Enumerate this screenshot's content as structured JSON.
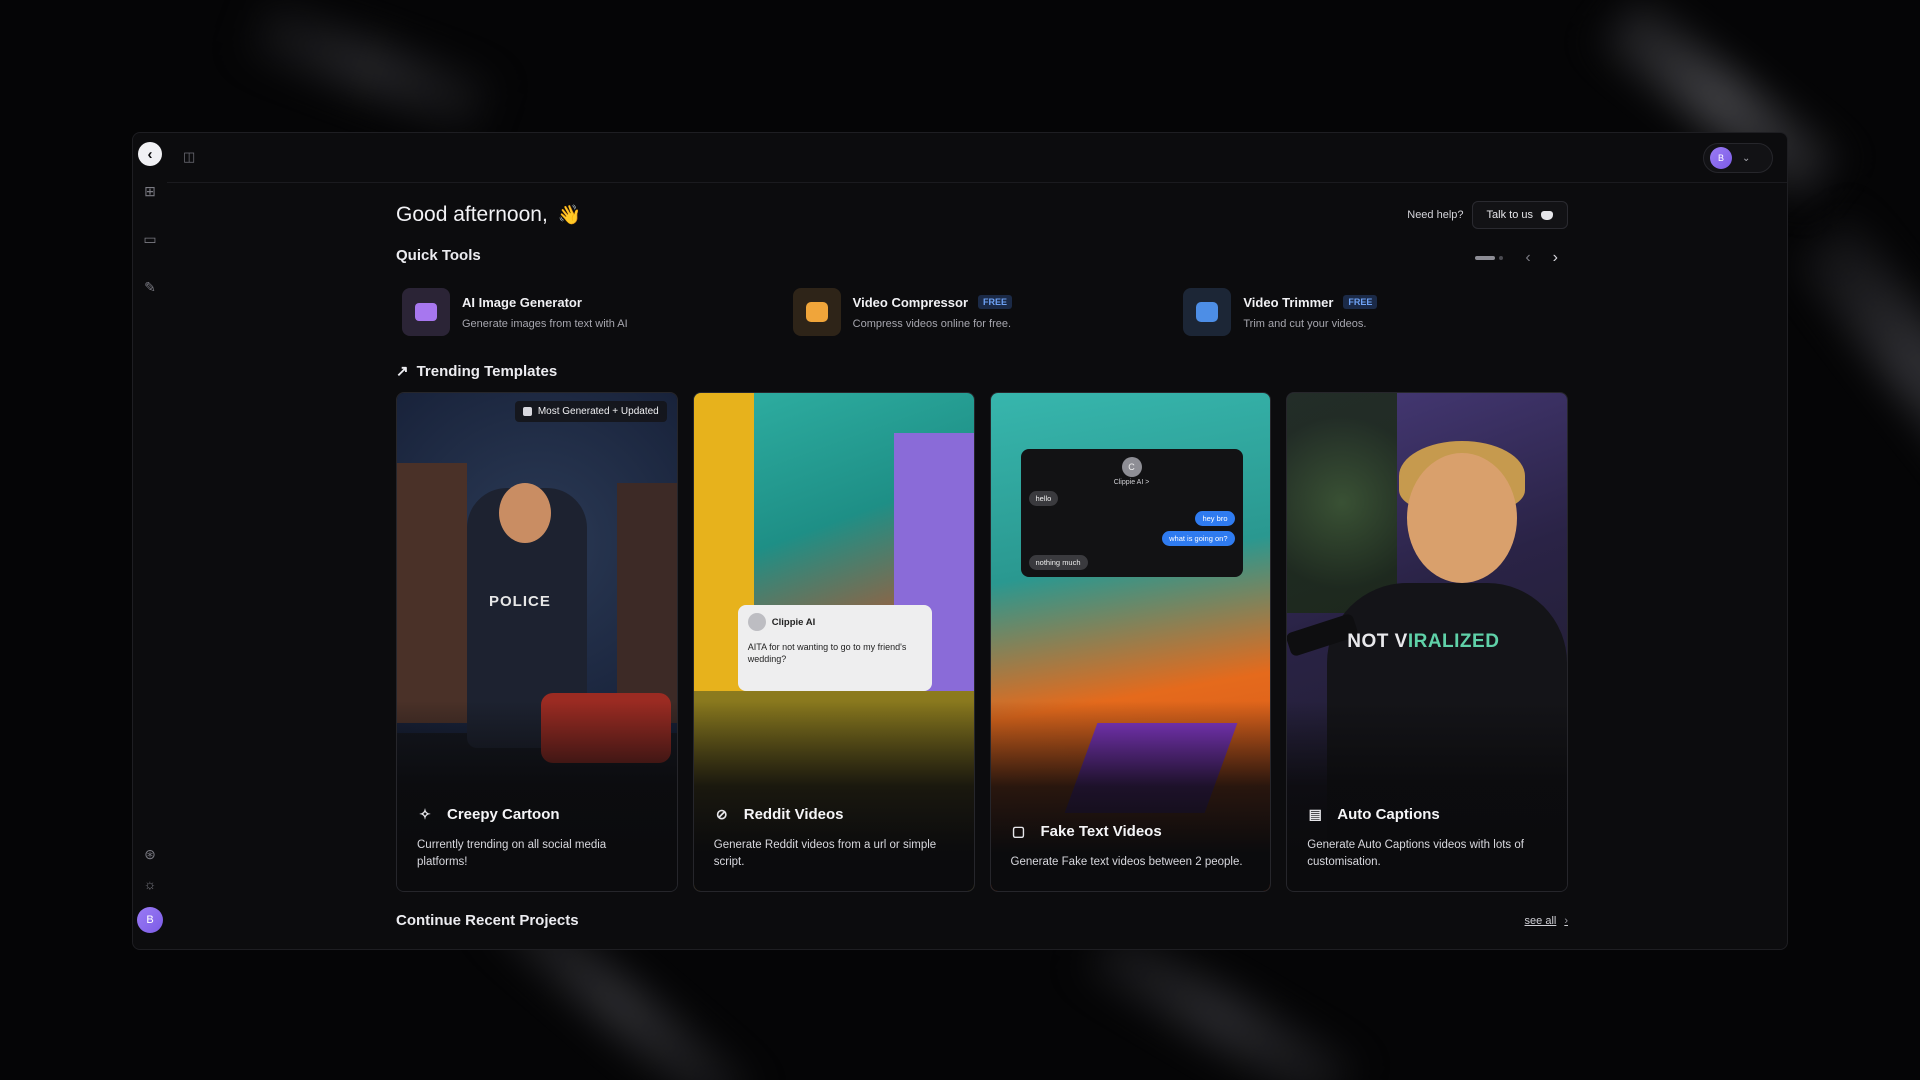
{
  "header": {
    "user_initial": "B"
  },
  "sidebar": {
    "items": [
      {
        "icon": "grid-icon"
      },
      {
        "icon": "clapperboard-icon"
      },
      {
        "icon": "wrench-icon"
      }
    ],
    "bottom": [
      {
        "icon": "settings-icon"
      },
      {
        "icon": "bug-icon"
      }
    ],
    "user_initial": "B"
  },
  "main": {
    "greeting": "Good afternoon,",
    "greeting_emoji": "👋",
    "help_text": "Need help?",
    "talk_button": "Talk to us",
    "quick_tools_title": "Quick Tools",
    "quick_tools": [
      {
        "name": "AI Image Generator",
        "desc": "Generate images from text with AI",
        "badge": ""
      },
      {
        "name": "Video Compressor",
        "desc": "Compress videos online for free.",
        "badge": "FREE"
      },
      {
        "name": "Video Trimmer",
        "desc": "Trim and cut your videos.",
        "badge": "FREE"
      }
    ],
    "trending_title": "Trending Templates",
    "templates": [
      {
        "title": "Creepy Cartoon",
        "desc": "Currently trending on all social media platforms!",
        "badge": "Most Generated + Updated",
        "art_text": "POLICE"
      },
      {
        "title": "Reddit Videos",
        "desc": "Generate Reddit videos from a url or simple script.",
        "post_user": "Clippie AI",
        "post_text": "AITA for not wanting to go to my friend's wedding?"
      },
      {
        "title": "Fake Text Videos",
        "desc": "Generate Fake text videos between 2 people.",
        "chat_name": "Clippie AI >",
        "chat_avatar": "C",
        "messages": [
          "hello",
          "hey bro",
          "what is going on?",
          "nothing much"
        ]
      },
      {
        "title": "Auto Captions",
        "desc": "Generate Auto Captions videos with lots of customisation.",
        "caption_a": "NOT V",
        "caption_b": "IRALIZED"
      }
    ],
    "recent_title": "Continue Recent Projects",
    "see_all": "see all"
  },
  "colors": {
    "background": "#050506",
    "panel": "#0c0c0e",
    "accent_purple": "#9a7bf5",
    "free_badge": "#6ea2f5"
  }
}
